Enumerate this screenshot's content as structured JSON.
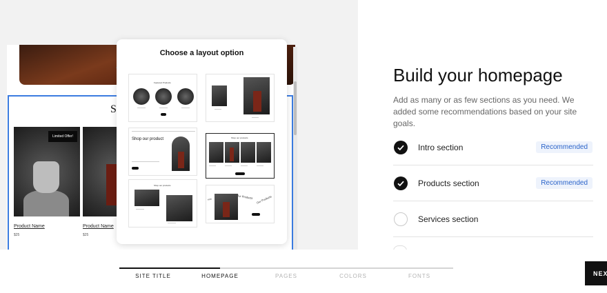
{
  "popover": {
    "title": "Choose a layout option",
    "options": [
      {
        "heading": "Featured Products"
      },
      {
        "heading": ""
      },
      {
        "heading": "Shop our product"
      },
      {
        "heading": "Shop our products"
      },
      {
        "heading": "Shop our products"
      },
      {
        "heading": "Our Products"
      }
    ]
  },
  "preview": {
    "section_heading": "S",
    "badge": "Limited Offer!",
    "products": [
      {
        "name": "Product Name",
        "price": "$25"
      },
      {
        "name": "Product Name",
        "price": "$25"
      }
    ]
  },
  "panel": {
    "title": "Build your homepage",
    "description": "Add as many or as few sections as you need. We added some recommendations based on your site goals.",
    "sections": [
      {
        "label": "Intro section",
        "checked": true,
        "badge": "Recommended"
      },
      {
        "label": "Products section",
        "checked": true,
        "badge": "Recommended"
      },
      {
        "label": "Services section",
        "checked": false,
        "badge": ""
      }
    ]
  },
  "steps": [
    {
      "label": "SITE TITLE",
      "state": "done"
    },
    {
      "label": "HOMEPAGE",
      "state": "active"
    },
    {
      "label": "PAGES",
      "state": "todo"
    },
    {
      "label": "COLORS",
      "state": "todo"
    },
    {
      "label": "FONTS",
      "state": "todo"
    }
  ],
  "next_label": "NEXT",
  "colors": {
    "accent": "#3a7be0",
    "badge_text": "#2a63c9",
    "badge_bg": "#eef3fc"
  }
}
